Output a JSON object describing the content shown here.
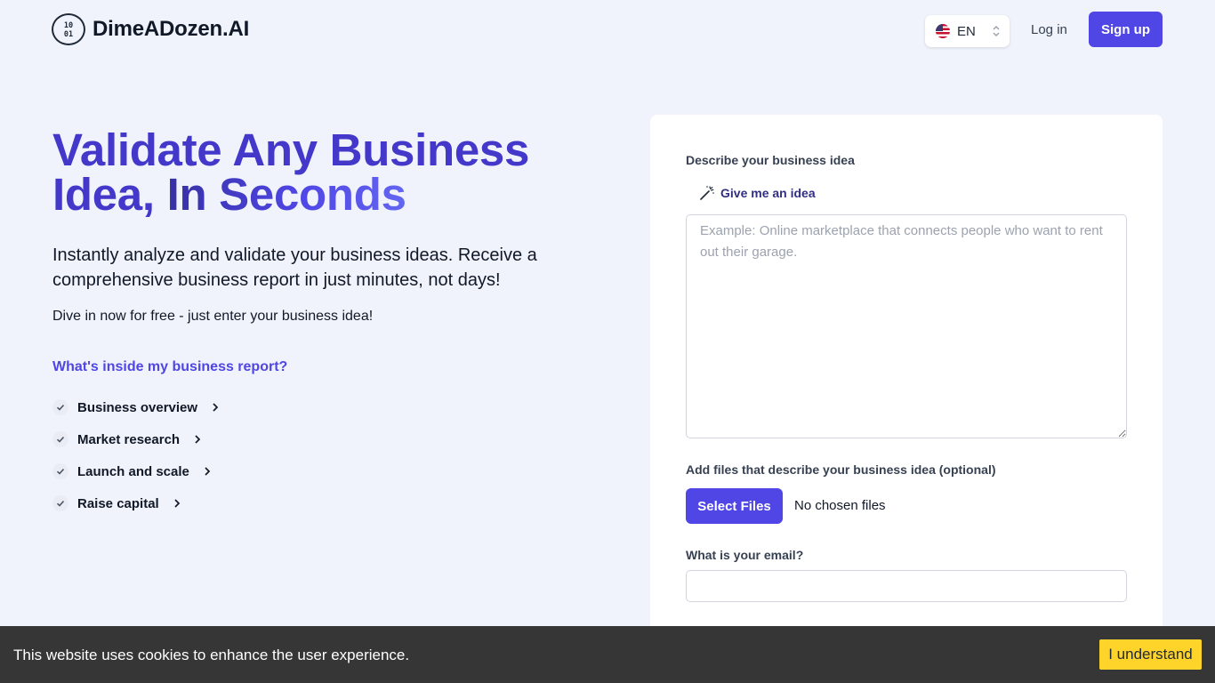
{
  "header": {
    "brand": "DimeADozen.AI",
    "language": "EN",
    "login_label": "Log in",
    "signup_label": "Sign up"
  },
  "hero": {
    "title_part1": "Validate Any Business Idea, ",
    "title_accent": "In Seconds",
    "subtitle": "Instantly analyze and validate your business ideas. Receive a comprehensive business report in just minutes, not days!",
    "cta_text": "Dive in now for free - just enter your business idea!"
  },
  "report": {
    "heading": "What's inside my business report?",
    "items": [
      {
        "label": "Business overview"
      },
      {
        "label": "Market research"
      },
      {
        "label": "Launch and scale"
      },
      {
        "label": "Raise capital"
      }
    ]
  },
  "form": {
    "idea_label": "Describe your business idea",
    "idea_button": "Give me an idea",
    "idea_placeholder": "Example: Online marketplace that connects people who want to rent out their garage.",
    "idea_value": "",
    "files_label": "Add files that describe your business idea (optional)",
    "select_files_label": "Select Files",
    "no_files_text": "No chosen files",
    "email_label": "What is your email?",
    "email_value": ""
  },
  "cookie": {
    "text": "This website uses cookies to enhance the user experience.",
    "button_label": "I understand"
  },
  "colors": {
    "primary": "#4f46e5",
    "title": "#4338ca",
    "background": "#f0f3fb",
    "cookie_bg": "#363636",
    "cookie_button": "#ffd42a"
  }
}
